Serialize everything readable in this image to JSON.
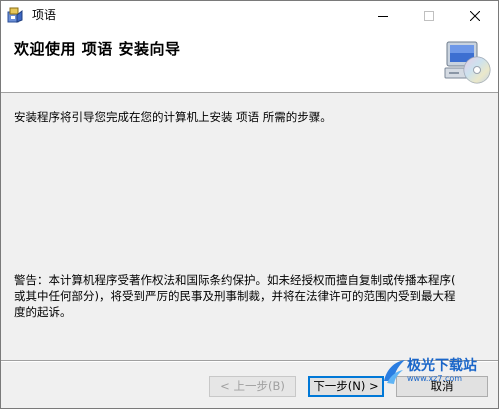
{
  "window": {
    "title": "项语",
    "icon": "installer-package-icon"
  },
  "header": {
    "title": "欢迎使用 项语 安装向导",
    "art_icon": "computer-cd-icon"
  },
  "body": {
    "intro": "安装程序将引导您完成在您的计算机上安装 项语 所需的步骤。",
    "warning_line1": "警告：本计算机程序受著作权法和国际条约保护。如未经授权而擅自复制或传播本程序(",
    "warning_line2": "或其中任何部分)，将受到严厉的民事及刑事制裁，并将在法律许可的范围内受到最大程",
    "warning_line3": "度的起诉。"
  },
  "buttons": {
    "back": "< 上一步(B)",
    "next": "下一步(N) >",
    "cancel": "取消"
  },
  "watermark": {
    "name": "极光下载站",
    "url": "www.xz7.com",
    "color": "#1a66c9"
  },
  "colors": {
    "focus_border": "#0078d7",
    "disabled_text": "#a0a0a0"
  }
}
